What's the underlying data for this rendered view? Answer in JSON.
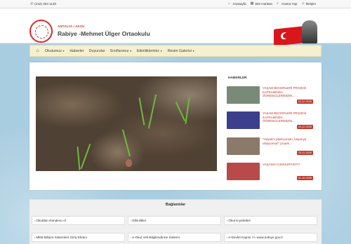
{
  "topbar": {
    "phone": "(242) 464 1140",
    "links": [
      {
        "icon": "home-icon",
        "label": "Anasayfa"
      },
      {
        "icon": "sitemap-icon",
        "label": "Site Haritası"
      },
      {
        "icon": "search-icon",
        "label": "Arama Yap"
      },
      {
        "icon": "user-icon",
        "label": "İletişim"
      }
    ]
  },
  "header": {
    "city": "ANTALYA / AKSU",
    "school": "Rabiye -Mehmet Ülger Ortaokulu"
  },
  "nav": {
    "items": [
      {
        "label": "Okulumuz",
        "dropdown": true
      },
      {
        "label": "Haberler",
        "dropdown": false
      },
      {
        "label": "Duyurular",
        "dropdown": false
      },
      {
        "label": "Sınıflarımız",
        "dropdown": true
      },
      {
        "label": "Etkinliklerimiz",
        "dropdown": true
      },
      {
        "label": "Resim Galerisi",
        "dropdown": true
      }
    ]
  },
  "news": {
    "title": "HABERLER",
    "items": [
      {
        "text": "YAŞAM BECERİLERİ PROJESİ KAPSAMINDA ÖĞRENCİLERİMİZİN...",
        "date": "16-12-2025",
        "thumb_color": "#7a8a78"
      },
      {
        "text": "YAŞAM BECERİLERİ PROJESİ KAPSAMINDA ÖĞRENCİLERİMİZİN...",
        "date": "16-12-2025",
        "thumb_color": "#3b3f8c"
      },
      {
        "text": "\"Hayatını planlıyorsan, başarıya ulaşıyorsun\" projesi...",
        "date": "25-11-2025",
        "thumb_color": "#8b7a6a"
      },
      {
        "text": "YAŞASIN CUMHURİYET!!!",
        "date": "31-10-2025",
        "thumb_color": "#b84a4a"
      }
    ]
  },
  "links_section": {
    "title": "Bağlantılar",
    "items": [
      "Okuldan Randevu Al",
      "Etkinlikler",
      "Okul Kıyafetleri",
      "MEB Bilişim Sistemleri Giriş Ekranı",
      "e-Okul Veli Bilgilendirme Sistemi",
      "e-Devlet Kapısı >> www.turkiye.gov.tr"
    ]
  }
}
